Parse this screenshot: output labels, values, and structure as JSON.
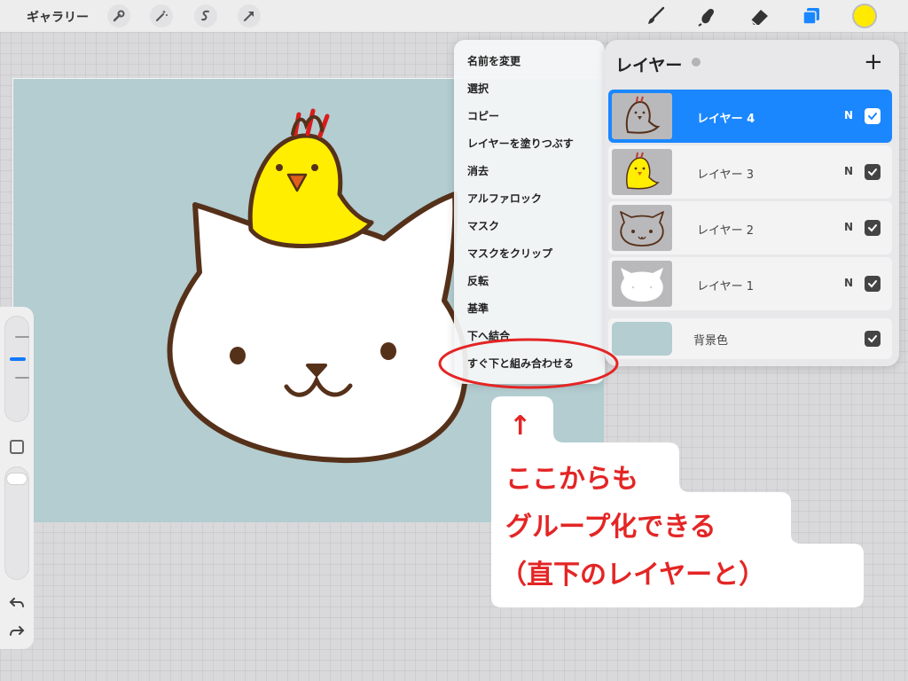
{
  "toolbar": {
    "gallery_label": "ギャラリー",
    "left_icons": [
      "wrench-icon",
      "magic-wand-icon",
      "selection-icon",
      "transform-arrow-icon"
    ],
    "right_icons": [
      "brush-icon",
      "smudge-icon",
      "eraser-icon",
      "layers-icon"
    ],
    "current_color": "#ffea00",
    "accent_color": "#1a87ff"
  },
  "canvas": {
    "background_color": "#b3cdd1",
    "artwork": "cat-with-chick"
  },
  "context_menu": {
    "items": [
      "名前を変更",
      "選択",
      "コピー",
      "レイヤーを塗りつぶす",
      "消去",
      "アルファロック",
      "マスク",
      "マスクをクリップ",
      "反転",
      "基準",
      "下へ結合",
      "すぐ下と組み合わせる"
    ],
    "highlighted_item": "すぐ下と組み合わせる"
  },
  "layers_panel": {
    "title": "レイヤー",
    "add_label": "+",
    "layers": [
      {
        "name": "レイヤー 4",
        "mode": "N",
        "visible": true,
        "selected": true
      },
      {
        "name": "レイヤー 3",
        "mode": "N",
        "visible": true,
        "selected": false
      },
      {
        "name": "レイヤー 2",
        "mode": "N",
        "visible": true,
        "selected": false
      },
      {
        "name": "レイヤー 1",
        "mode": "N",
        "visible": true,
        "selected": false
      }
    ],
    "background": {
      "name": "背景色",
      "visible": true,
      "color": "#b3cdd1"
    }
  },
  "annotation": {
    "arrow": "↑",
    "line1": "ここからも",
    "line2": "グループ化できる",
    "line3": "（直下のレイヤーと）",
    "color": "#e42525"
  }
}
